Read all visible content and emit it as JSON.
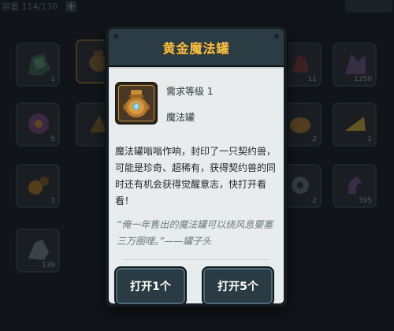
{
  "inventory": {
    "capacity_label": "容量 114/130",
    "slots": [
      {
        "count": "1"
      },
      {
        "count": ""
      },
      {
        "count": "11"
      },
      {
        "count": "1250"
      },
      {
        "count": "5"
      },
      {
        "count": ""
      },
      {
        "count": "2"
      },
      {
        "count": "1"
      },
      {
        "count": "3"
      },
      {
        "count": "2"
      },
      {
        "count": "395"
      },
      {
        "count": "139"
      }
    ]
  },
  "dialog": {
    "title": "黄金魔法罐",
    "required_level": "需求等级 1",
    "item_name": "魔法罐",
    "description": "魔法罐嗡嗡作响，封印了一只契约兽，可能是珍奇、超稀有，获得契约兽的同时还有机会获得觉醒意志，快打开看看！",
    "quote": "“俺一年售出的魔法罐可以绕风息要塞三万圈哩。”——罐子头",
    "buttons": {
      "open_one": "打开1个",
      "open_five": "打开5个"
    }
  },
  "colors": {
    "title_gold": "#f6c24b",
    "panel_bg": "#e9eced",
    "button_bg": "#2b3b44"
  },
  "icons": [
    "plus-icon",
    "golden-jar-icon"
  ]
}
